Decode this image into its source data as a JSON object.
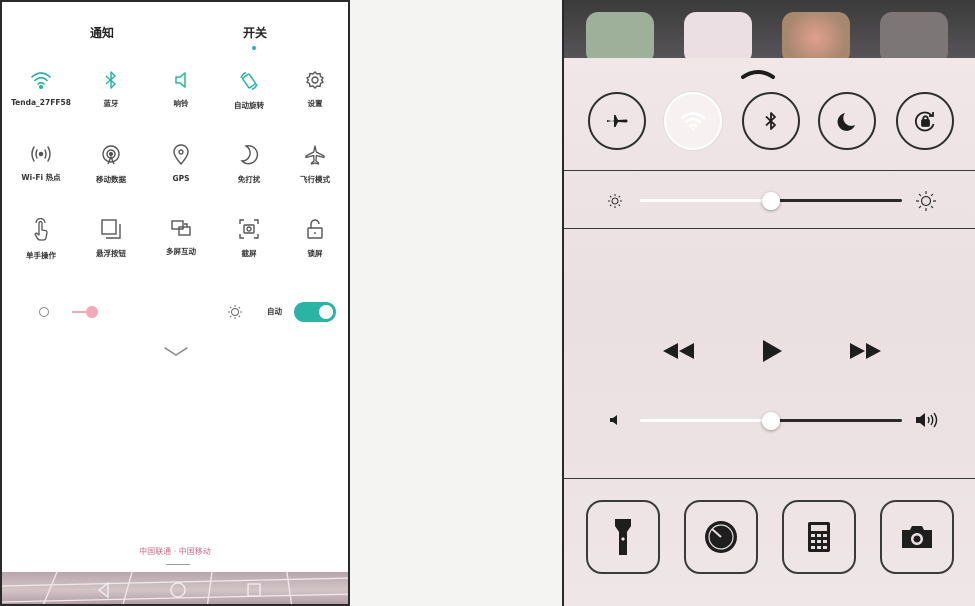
{
  "left_panel": {
    "tabs": [
      {
        "label": "通知",
        "active": false
      },
      {
        "label": "开关",
        "active": true
      }
    ],
    "tiles": [
      {
        "label": "Tenda_27FF58",
        "icon": "wifi-icon",
        "active": true
      },
      {
        "label": "蓝牙",
        "icon": "bluetooth-icon",
        "active": true
      },
      {
        "label": "响铃",
        "icon": "ringer-icon",
        "active": true
      },
      {
        "label": "自动旋转",
        "icon": "auto-rotate-icon",
        "active": true
      },
      {
        "label": "设置",
        "icon": "settings-icon",
        "active": false
      },
      {
        "label": "Wi-Fi 热点",
        "icon": "hotspot-icon",
        "active": false
      },
      {
        "label": "移动数据",
        "icon": "mobile-data-icon",
        "active": false
      },
      {
        "label": "GPS",
        "icon": "location-icon",
        "active": false
      },
      {
        "label": "免打扰",
        "icon": "moon-icon",
        "active": false
      },
      {
        "label": "飞行模式",
        "icon": "airplane-icon",
        "active": false
      },
      {
        "label": "单手操作",
        "icon": "one-hand-icon",
        "active": false
      },
      {
        "label": "悬浮按钮",
        "icon": "floating-button-icon",
        "active": false
      },
      {
        "label": "多屏互动",
        "icon": "multi-screen-icon",
        "active": false
      },
      {
        "label": "截屏",
        "icon": "screenshot-icon",
        "active": false
      },
      {
        "label": "锁屏",
        "icon": "lock-icon",
        "active": false
      }
    ],
    "brightness": {
      "auto_label": "自动",
      "auto_enabled": true,
      "level": 0.15
    },
    "carrier_text": "中国联通 · 中国移动",
    "colors": {
      "accent": "#2bb3a3",
      "brightness_thumb": "#f1a9b6"
    }
  },
  "right_panel": {
    "toggles": [
      {
        "icon": "airplane-icon",
        "active": false
      },
      {
        "icon": "wifi-icon",
        "active": true
      },
      {
        "icon": "bluetooth-icon",
        "active": false
      },
      {
        "icon": "moon-icon",
        "active": false
      },
      {
        "icon": "rotation-lock-icon",
        "active": false
      }
    ],
    "brightness_level": 0.5,
    "volume_level": 0.5,
    "media": [
      "rewind-icon",
      "play-icon",
      "fast-forward-icon"
    ],
    "shortcuts": [
      "flashlight-icon",
      "timer-icon",
      "calculator-icon",
      "camera-icon"
    ]
  }
}
